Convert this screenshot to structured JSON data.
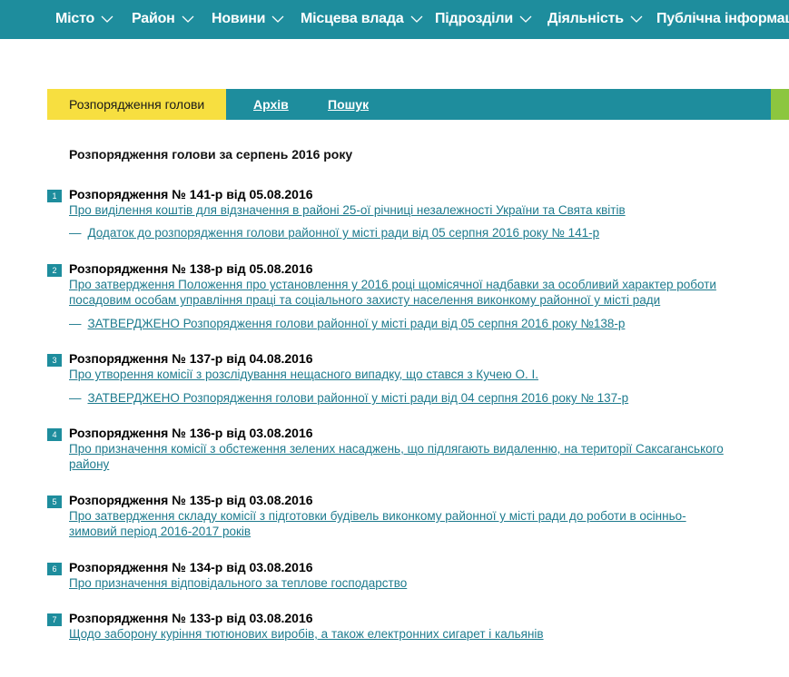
{
  "nav": {
    "items": [
      {
        "label": "Місто",
        "has_dropdown": true
      },
      {
        "label": "Район",
        "has_dropdown": true
      },
      {
        "label": "Новини",
        "has_dropdown": true
      },
      {
        "label": "Місцева влада",
        "has_dropdown": true
      },
      {
        "label": "Підрозділи",
        "has_dropdown": true
      },
      {
        "label": "Діяльність",
        "has_dropdown": true
      },
      {
        "label": "Публічна інформація",
        "has_dropdown": false
      }
    ]
  },
  "tabs": {
    "active": "Розпорядження голови",
    "archive": "Архів",
    "search": "Пошук"
  },
  "page_title": "Розпорядження голови за серпень 2016 року",
  "entries": [
    {
      "num": "1",
      "title": "Розпорядження № 141-р від 05.08.2016",
      "desc": "Про виділення коштів для відзначення в районі 25-ої річниці незалежності України та Свята квітів",
      "attachment": "Додаток до розпорядження голови районної у місті ради від 05 серпня 2016 року № 141-р"
    },
    {
      "num": "2",
      "title": "Розпорядження № 138-р від 05.08.2016",
      "desc": "Про затвердження Положення про установлення у 2016 році щомісячної надбавки за особливий характер роботи посадовим особам управління праці та соціального захисту населення виконкому районної у місті ради",
      "attachment": "ЗАТВЕРДЖЕНО Розпорядження голови районної у місті ради від 05 серпня 2016 року №138-р"
    },
    {
      "num": "3",
      "title": "Розпорядження № 137-р від 04.08.2016",
      "desc": "Про утворення комісії з розслідування нещасного випадку, що стався з Кучею О. І.",
      "attachment": "ЗАТВЕРДЖЕНО Розпорядження голови районної у місті ради від 04 серпня 2016 року № 137-р"
    },
    {
      "num": "4",
      "title": "Розпорядження № 136-р від 03.08.2016",
      "desc": "Про призначення комісії з обстеження зелених насаджень, що підлягають видаленню, на території Саксаганського району"
    },
    {
      "num": "5",
      "title": "Розпорядження № 135-р від 03.08.2016",
      "desc": "Про затвердження складу комісії з підготовки будівель виконкому районної у місті ради до роботи в осінньо-зимовий період 2016-2017 років"
    },
    {
      "num": "6",
      "title": "Розпорядження № 134-р від 03.08.2016",
      "desc": "Про призначення відповідального за теплове господарство"
    },
    {
      "num": "7",
      "title": "Розпорядження № 133-р від 03.08.2016",
      "desc": "Щодо заборону куріння тютюнових виробів, а також електронних сигарет і кальянів"
    }
  ]
}
